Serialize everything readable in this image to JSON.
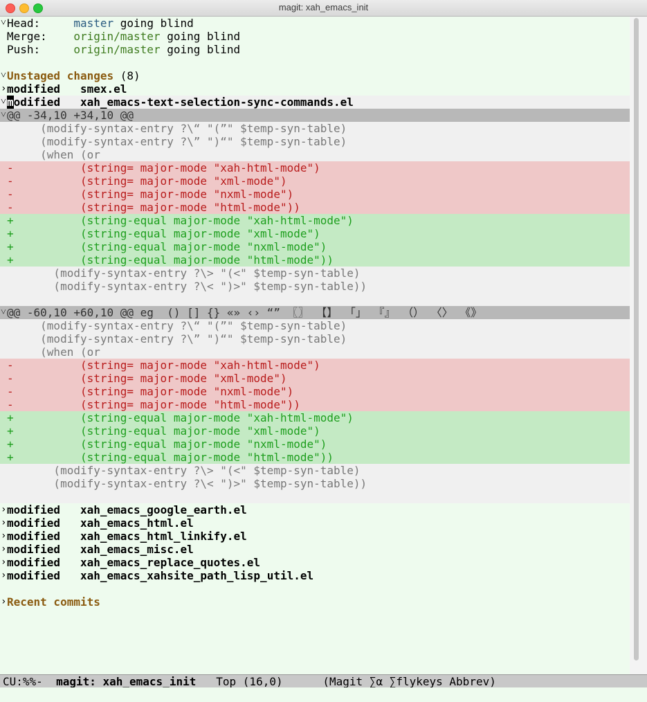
{
  "window": {
    "title": "magit: xah_emacs_init"
  },
  "head": [
    {
      "label": "Head:",
      "ref": "master",
      "message": "going blind"
    },
    {
      "label": "Merge:",
      "ref": "origin/master",
      "message": "going blind"
    },
    {
      "label": "Push:",
      "ref": "origin/master",
      "message": "going blind"
    }
  ],
  "unstaged": {
    "title": "Unstaged changes",
    "count": "(8)",
    "file1": {
      "status": "modified",
      "name": "smex.el"
    },
    "file2": {
      "status": "modified",
      "name": "xah_emacs-text-selection-sync-commands.el"
    },
    "hunk1": {
      "header": "@@ -34,10 +34,10 @@",
      "lines": [
        "     (modify-syntax-entry ?\\“ \"(”\" $temp-syn-table)",
        "     (modify-syntax-entry ?\\” \")“\" $temp-syn-table)",
        "     (when (or",
        "-          (string= major-mode \"xah-html-mode\")",
        "-          (string= major-mode \"xml-mode\")",
        "-          (string= major-mode \"nxml-mode\")",
        "-          (string= major-mode \"html-mode\"))",
        "+          (string-equal major-mode \"xah-html-mode\")",
        "+          (string-equal major-mode \"xml-mode\")",
        "+          (string-equal major-mode \"nxml-mode\")",
        "+          (string-equal major-mode \"html-mode\"))",
        "       (modify-syntax-entry ?\\> \"(<\" $temp-syn-table)",
        "       (modify-syntax-entry ?\\< \")>\" $temp-syn-table))"
      ]
    },
    "hunk2": {
      "header": "@@ -60,10 +60,10 @@ eg  () [] {} «» ‹› “” 〖〗 【】 「」 『』 （） 〈〉 《》",
      "lines": [
        "     (modify-syntax-entry ?\\“ \"(”\" $temp-syn-table)",
        "     (modify-syntax-entry ?\\” \")“\" $temp-syn-table)",
        "     (when (or",
        "-          (string= major-mode \"xah-html-mode\")",
        "-          (string= major-mode \"xml-mode\")",
        "-          (string= major-mode \"nxml-mode\")",
        "-          (string= major-mode \"html-mode\"))",
        "+          (string-equal major-mode \"xah-html-mode\")",
        "+          (string-equal major-mode \"xml-mode\")",
        "+          (string-equal major-mode \"nxml-mode\")",
        "+          (string-equal major-mode \"html-mode\"))",
        "       (modify-syntax-entry ?\\> \"(<\" $temp-syn-table)",
        "       (modify-syntax-entry ?\\< \")>\" $temp-syn-table))"
      ]
    },
    "rest": [
      {
        "status": "modified",
        "name": "xah_emacs_google_earth.el"
      },
      {
        "status": "modified",
        "name": "xah_emacs_html.el"
      },
      {
        "status": "modified",
        "name": "xah_emacs_html_linkify.el"
      },
      {
        "status": "modified",
        "name": "xah_emacs_misc.el"
      },
      {
        "status": "modified",
        "name": "xah_emacs_replace_quotes.el"
      },
      {
        "status": "modified",
        "name": "xah_emacs_xahsite_path_lisp_util.el"
      }
    ]
  },
  "recent": {
    "title": "Recent commits"
  },
  "modeline": {
    "state": "CU:%%-",
    "buffer": "magit: xah_emacs_init",
    "position": "Top (16,0)",
    "modes": "(Magit ∑α ∑flykeys Abbrev)"
  }
}
